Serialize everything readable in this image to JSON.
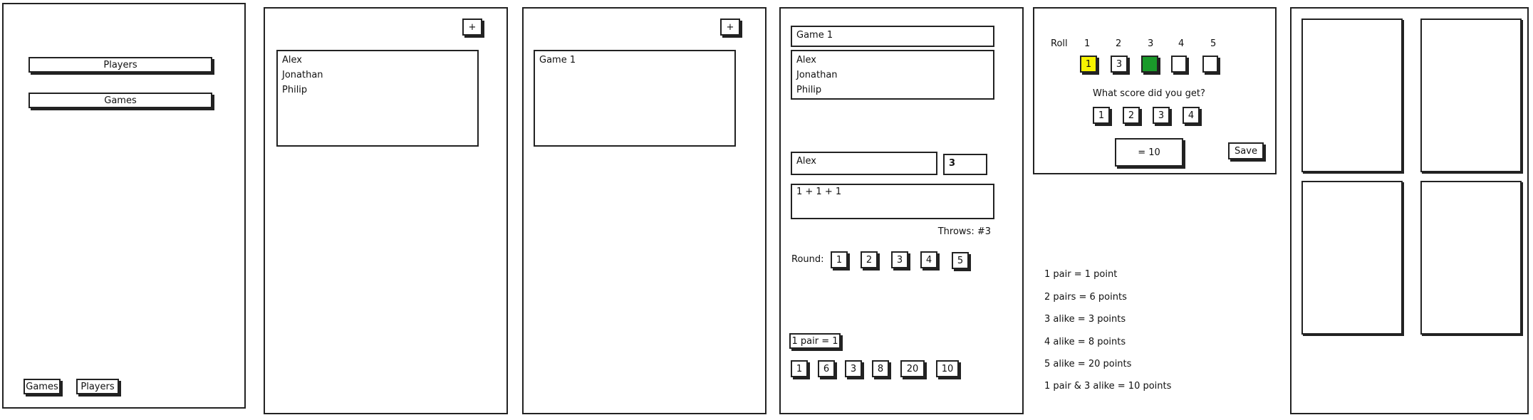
{
  "home": {
    "players_label": "Players",
    "games_label": "Games",
    "tab_games": "Games",
    "tab_players": "Players"
  },
  "players_screen": {
    "add_label": "+",
    "players": [
      "Alex",
      "Jonathan",
      "Philip"
    ]
  },
  "games_screen": {
    "add_label": "+",
    "games": [
      "Game 1"
    ]
  },
  "game_screen": {
    "title": "Game 1",
    "players": [
      "Alex",
      "Jonathan",
      "Philip"
    ],
    "current_player": "Alex",
    "current_score": "3",
    "history": "1 + 1 + 1",
    "throws": "Throws: #3",
    "round_label": "Round:",
    "rounds": [
      "1",
      "2",
      "3",
      "4",
      "5"
    ],
    "combo_label": "1 pair = 1",
    "points": [
      "1",
      "6",
      "3",
      "8",
      "20",
      "10"
    ]
  },
  "roll_screen": {
    "roll_label": "Roll",
    "roll_numbers": [
      "1",
      "2",
      "3",
      "4",
      "5"
    ],
    "dice": [
      {
        "value": "1",
        "color": "#f7f300"
      },
      {
        "value": "3",
        "color": "#ffffff"
      },
      {
        "value": "",
        "color": "#1a9a2a"
      },
      {
        "value": "",
        "color": "#ffffff"
      },
      {
        "value": "",
        "color": "#ffffff"
      }
    ],
    "question": "What score did you get?",
    "scores": [
      "1",
      "2",
      "3",
      "4"
    ],
    "total": "= 10",
    "save_label": "Save"
  },
  "rules": [
    "1 pair = 1 point",
    "2 pairs = 6 points",
    "3 alike = 3 points",
    "4 alike = 8 points",
    "5 alike = 20 points",
    "1 pair & 3 alike = 10 points"
  ]
}
